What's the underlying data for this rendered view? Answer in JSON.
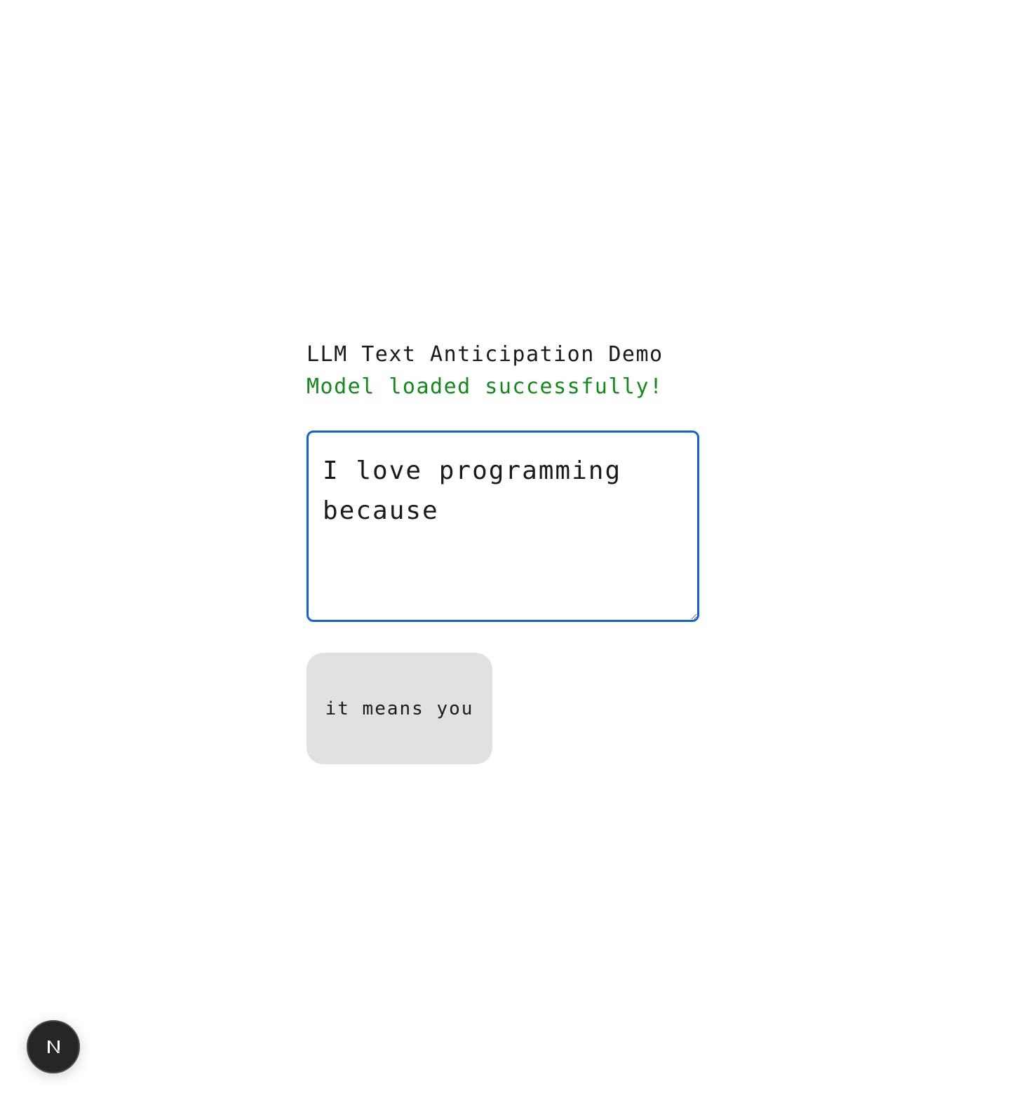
{
  "header": {
    "title": "LLM Text Anticipation Demo"
  },
  "status": {
    "message": "Model loaded successfully!",
    "color": "#11891b"
  },
  "editor": {
    "value": "I love programming because",
    "focus_color": "#1462d2"
  },
  "suggestion": {
    "text": "it means you"
  },
  "dev_badge": {
    "icon": "nextjs-logo-icon",
    "label": "N"
  }
}
